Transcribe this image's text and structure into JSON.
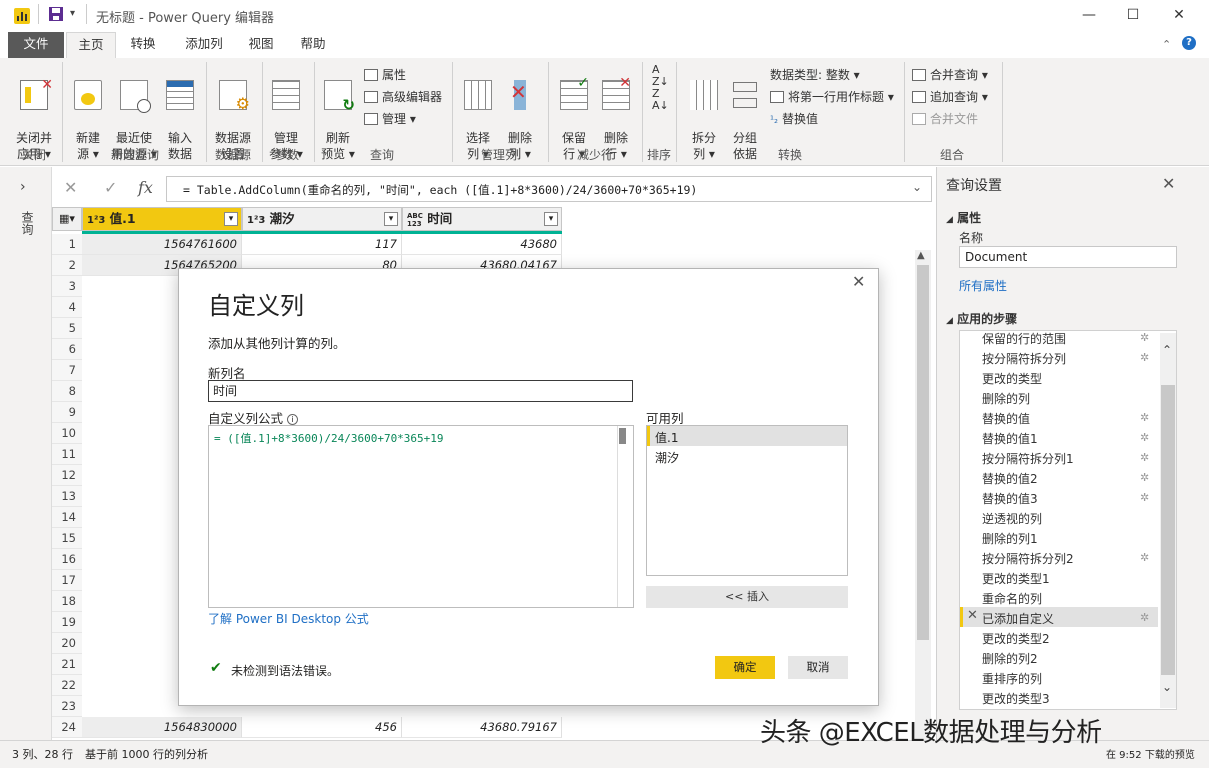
{
  "window": {
    "title": "无标题 - Power Query 编辑器",
    "minimize": "—",
    "maximize": "☐",
    "close": "✕"
  },
  "tabs": [
    "文件",
    "主页",
    "转换",
    "添加列",
    "视图",
    "帮助"
  ],
  "ribbon": {
    "close_apply": "关闭并\n应用 ▾",
    "new_source": "新建\n源 ▾",
    "recent_sources": "最近使\n用的源 ▾",
    "enter_data": "输入\n数据",
    "data_source_settings": "数据源\n设置",
    "manage_params": "管理\n参数 ▾",
    "refresh_preview": "刷新\n预览 ▾",
    "properties": "属性",
    "advanced_editor": "高级编辑器",
    "manage": "管理 ▾",
    "choose_columns": "选择\n列 ▾",
    "remove_columns": "删除\n列 ▾",
    "keep_rows": "保留\n行 ▾",
    "remove_rows": "删除\n行 ▾",
    "split_column": "拆分\n列 ▾",
    "group_by": "分组\n依据",
    "data_type": "数据类型: 整数 ▾",
    "first_row_header": "将第一行用作标题 ▾",
    "replace_values": "替换值",
    "merge_queries": "合并查询 ▾",
    "append_queries": "追加查询 ▾",
    "combine_files": "合并文件",
    "groups": [
      "关闭",
      "新建查询",
      "数据源",
      "参数",
      "查询",
      "管理列",
      "减少行",
      "排序",
      "转换",
      "组合"
    ]
  },
  "formula_bar": {
    "formula": "= Table.AddColumn(重命名的列, \"时间\", each ([值.1]+8*3600)/24/3600+70*365+19)"
  },
  "left_pane": {
    "label": "查询"
  },
  "grid": {
    "columns": [
      {
        "type": "1²3",
        "name": "值.1"
      },
      {
        "type": "1²3",
        "name": "潮汐"
      },
      {
        "type": "ABC\n123",
        "name": "时间"
      }
    ],
    "row_numbers": [
      "1",
      "2",
      "3",
      "4",
      "5",
      "6",
      "7",
      "8",
      "9",
      "10",
      "11",
      "12",
      "13",
      "14",
      "15",
      "16",
      "17",
      "18",
      "19",
      "20",
      "21",
      "22",
      "23",
      "24"
    ],
    "rows": [
      [
        "1564761600",
        "117",
        "43680"
      ],
      [
        "1564765200",
        "80",
        "43680.04167"
      ],
      [
        "1564830000",
        "456",
        "43680.79167"
      ]
    ]
  },
  "dialog": {
    "title": "自定义列",
    "subtitle": "添加从其他列计算的列。",
    "new_col_label": "新列名",
    "new_col_value": "时间",
    "formula_label": "自定义列公式",
    "formula": "= ([值.1]+8*3600)/24/3600+70*365+19",
    "available_label": "可用列",
    "available": [
      "值.1",
      "潮汐"
    ],
    "insert": "<< 插入",
    "learn_link": "了解 Power BI Desktop 公式",
    "status": "未检测到语法错误。",
    "ok": "确定",
    "cancel": "取消"
  },
  "query_settings": {
    "title": "查询设置",
    "properties": "属性",
    "name_label": "名称",
    "name_value": "Document",
    "all_properties": "所有属性",
    "applied_steps": "应用的步骤",
    "steps": [
      "保留的行的范围",
      "按分隔符拆分列",
      "更改的类型",
      "删除的列",
      "替换的值",
      "替换的值1",
      "按分隔符拆分列1",
      "替换的值2",
      "替换的值3",
      "逆透视的列",
      "删除的列1",
      "按分隔符拆分列2",
      "更改的类型1",
      "重命名的列",
      "已添加自定义",
      "更改的类型2",
      "删除的列2",
      "重排序的列",
      "更改的类型3"
    ]
  },
  "status_bar": {
    "rows": "3 列、28 行",
    "profile": "基于前 1000 行的列分析",
    "download": "在 9:52 下载的预览"
  },
  "watermark": "头条 @EXCEL数据处理与分析",
  "colors": {
    "accent": "#f2c811",
    "teal": "#00b294",
    "file_tab": "#595959"
  }
}
